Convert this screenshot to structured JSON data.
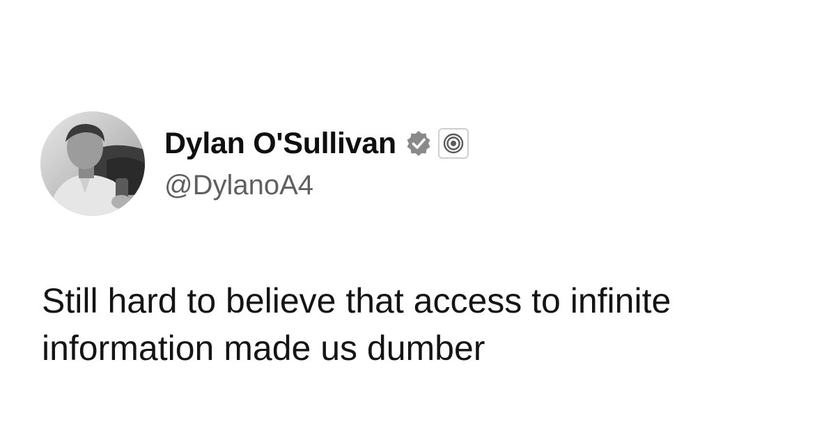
{
  "author": {
    "display_name": "Dylan O'Sullivan",
    "handle": "@DylanoA4",
    "avatar": "profile-photo",
    "badges": [
      "verified-check-icon",
      "affiliate-target-icon"
    ]
  },
  "tweet": {
    "text_lines": [
      "Still hard to believe that access to infinite",
      "information made us dumber"
    ]
  },
  "colors": {
    "background": "#ffffff",
    "name": "#0f0f0f",
    "handle": "#5f5f5f",
    "badge": "#8a8a8a"
  }
}
